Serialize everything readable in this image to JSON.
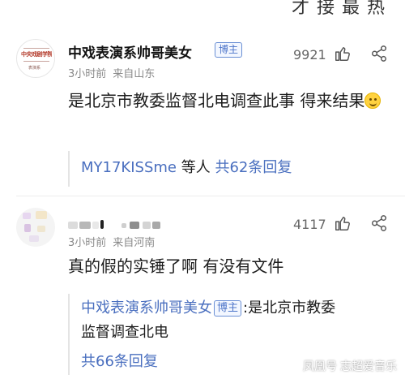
{
  "top_fragment": "才 接 最 热",
  "comments": [
    {
      "username": "中戏表演系帅哥美女",
      "badge": "博主",
      "avatar_logo_text": "中央戏剧学院",
      "avatar_logo_sub": "表演系",
      "time": "3小时前",
      "location": "来自山东",
      "likes": "9921",
      "text": "是北京市教委监督北电调查此事 得来结果",
      "emoji": "smile-emoji",
      "reply_summary": {
        "users": "MY17KISSme",
        "middle": " 等人 ",
        "count_label": "共62条回复"
      }
    },
    {
      "username": "",
      "time": "3小时前",
      "location": "来自河南",
      "likes": "4117",
      "text": "真的假的实锤了啊 有没有文件",
      "reply_preview": {
        "author": "中戏表演系帅哥美女",
        "badge": "博主",
        "line1_text": ":是北京市教委",
        "line2_text": "监督调查北电",
        "count_label": "共66条回复"
      }
    }
  ],
  "icons": {
    "like": "thumbs-up-icon",
    "share": "share-icon"
  },
  "watermark": {
    "left": "凤凰号",
    "right": "志超爱音乐"
  },
  "colors": {
    "link_blue": "#4a6fbf",
    "badge_blue": "#4d75c9",
    "meta_gray": "#8a8a8a",
    "emoji_yellow": "#ffd23f"
  }
}
